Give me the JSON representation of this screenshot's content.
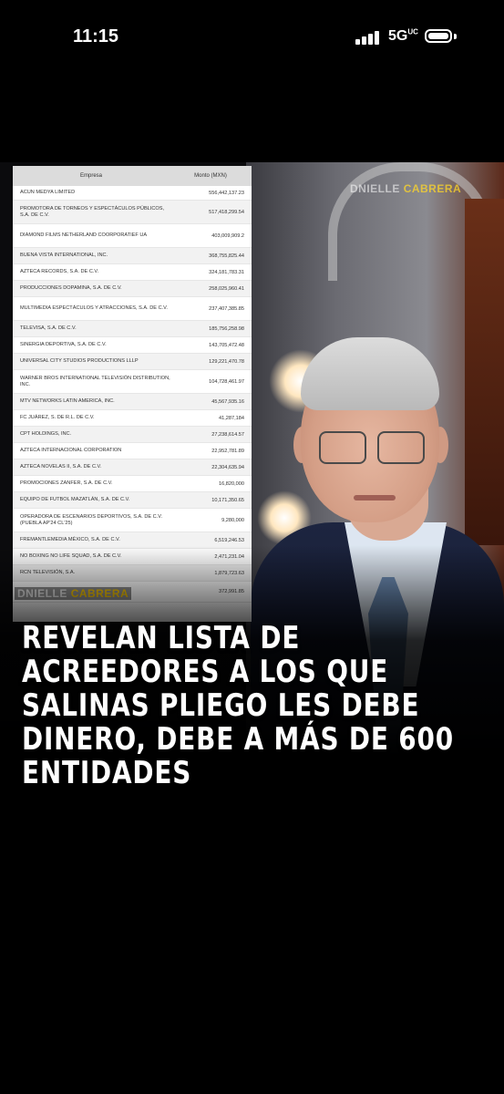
{
  "status_bar": {
    "time": "11:15",
    "network": "5G",
    "network_suffix": "UC"
  },
  "post": {
    "watermark_prefix": "DNIELLE",
    "watermark_name": "CABRERA",
    "table": {
      "headers": [
        "Empresa",
        "Monto (MXN)"
      ],
      "rows": [
        {
          "name": "ACUN MEDYA LIMITED",
          "amount": "556,442,137.23"
        },
        {
          "name": "PROMOTORA DE TORNEOS Y ESPECTÁCULOS PÚBLICOS, S.A. DE C.V.",
          "amount": "517,418,299.54"
        },
        {
          "name": "DIAMOND FILMS NETHERLAND COORPORATIEF UA",
          "amount": "403,009,909.2"
        },
        {
          "name": "BUENA VISTA INTERNATIONAL, INC.",
          "amount": "368,755,825.44"
        },
        {
          "name": "AZTECA RECORDS, S.A. DE C.V.",
          "amount": "324,181,783.31"
        },
        {
          "name": "PRODUCCIONES DOPAMINA, S.A. DE C.V.",
          "amount": "258,025,960.41"
        },
        {
          "name": "MULTIMEDIA ESPECTÁCULOS Y ATRACCIONES, S.A. DE C.V.",
          "amount": "237,407,385.85"
        },
        {
          "name": "TELEVISA, S.A. DE C.V.",
          "amount": "185,756,258.98"
        },
        {
          "name": "SINERGIA DEPORTIVA, S.A. DE C.V.",
          "amount": "143,705,472.48"
        },
        {
          "name": "UNIVERSAL CITY STUDIOS PRODUCTIONS LLLP",
          "amount": "129,221,470.78"
        },
        {
          "name": "WARNER BROS INTERNATIONAL TELEVISIÓN DISTRIBUTION, INC.",
          "amount": "104,728,461.97"
        },
        {
          "name": "MTV NETWORKS LATIN AMERICA, INC.",
          "amount": "45,567,935.16"
        },
        {
          "name": "FC JUÁREZ, S. DE R.L. DE C.V.",
          "amount": "41,287,184"
        },
        {
          "name": "CPT HOLDINGS, INC.",
          "amount": "27,238,614.57"
        },
        {
          "name": "AZTECA INTERNACIONAL CORPORATION",
          "amount": "22,952,781.89"
        },
        {
          "name": "AZTECA NOVELAS II, S.A. DE C.V.",
          "amount": "22,304,635.94"
        },
        {
          "name": "PROMOCIONES ZANFER, S.A. DE C.V.",
          "amount": "16,820,000"
        },
        {
          "name": "EQUIPO DE FUTBOL MAZATLÁN, S.A. DE C.V.",
          "amount": "10,171,350.65"
        },
        {
          "name": "OPERADORA DE ESCENARIOS DEPORTIVOS, S.A. DE C.V. (PUEBLA AP'24 CL'25)",
          "amount": "9,280,000"
        },
        {
          "name": "FREMANTLEMEDIA MÉXICO, S.A. DE C.V.",
          "amount": "6,519,246.53"
        },
        {
          "name": "NO BOXING NO LIFE SQUAD, S.A. DE C.V.",
          "amount": "2,471,231.04"
        },
        {
          "name": "RCN TELEVISIÓN, S.A.",
          "amount": "1,879,723.63"
        },
        {
          "name": "",
          "amount": "372,991.85"
        }
      ]
    },
    "headline": "REVELAN LISTA DE ACREEDORES A LOS QUE SALINAS PLIEGO LES DEBE DINERO, DEBE A MÁS DE 600 ENTIDADES"
  }
}
